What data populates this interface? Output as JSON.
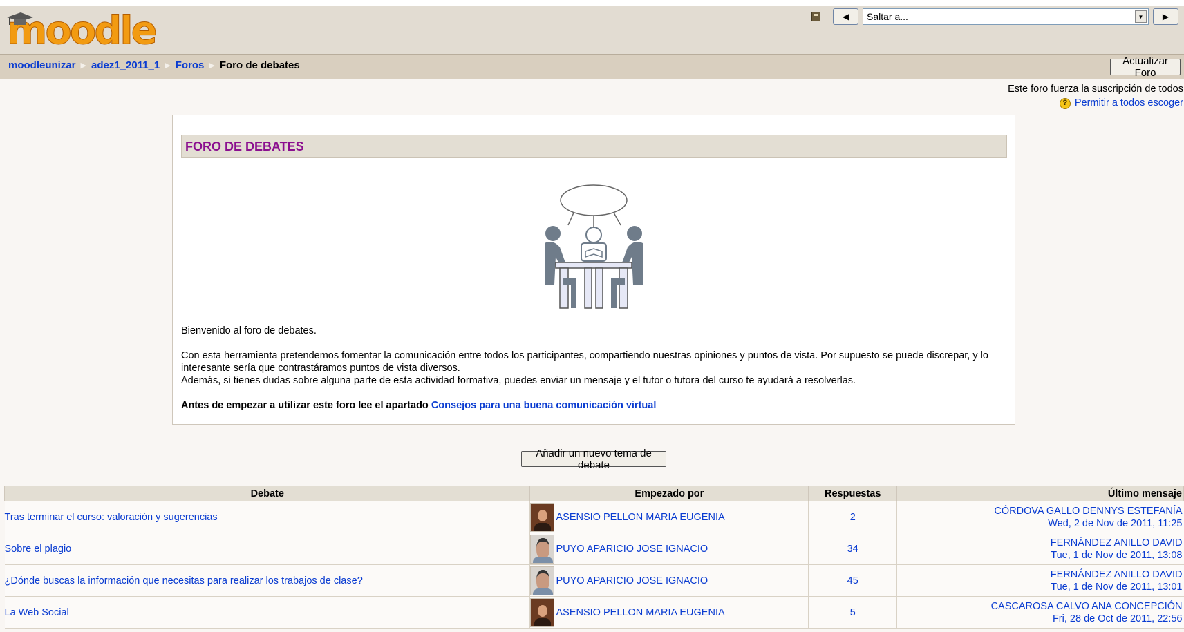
{
  "logo": {
    "text": "moodle"
  },
  "header": {
    "jump_select": {
      "value": "Saltar a..."
    },
    "prev_label": "◀",
    "next_label": "▶"
  },
  "breadcrumb": {
    "items": [
      "moodleunizar",
      "adez1_2011_1",
      "Foros"
    ],
    "current": "Foro de debates"
  },
  "update_button": "Actualizar Foro",
  "subscription": {
    "notice": "Este foro fuerza la suscripción de todos",
    "link": "Permitir a todos escoger"
  },
  "forum": {
    "heading": "FORO DE DEBATES",
    "welcome": "Bienvenido al foro de debates.",
    "paragraph1": "Con esta herramienta pretendemos fomentar la comunicación entre todos los participantes, compartiendo nuestras opiniones y puntos de vista. Por supuesto se puede discrepar, y lo interesante sería que contrastáramos puntos de vista diversos.",
    "paragraph2": "Además, si tienes dudas sobre alguna parte de esta actividad formativa, puedes enviar un mensaje y el tutor o tutora del curso te ayudará a resolverlas.",
    "advice_prefix": "Antes de empezar a utilizar este foro lee el apartado ",
    "advice_link": "Consejos para una buena comunicación virtual"
  },
  "add_topic_button": "Añadir un nuevo tema de debate",
  "table": {
    "headers": {
      "debate": "Debate",
      "started_by": "Empezado por",
      "replies": "Respuestas",
      "last_post": "Último mensaje"
    },
    "rows": [
      {
        "debate": "Tras terminar el curso: valoración y sugerencias",
        "avatar": "woman",
        "started_by": "ASENSIO PELLON MARIA EUGENIA",
        "replies": "2",
        "last_author": "CÓRDOVA GALLO DENNYS ESTEFANÍA",
        "last_date": "Wed, 2 de Nov de 2011, 11:25"
      },
      {
        "debate": "Sobre el plagio",
        "avatar": "man",
        "started_by": "PUYO APARICIO JOSE IGNACIO",
        "replies": "34",
        "last_author": "FERNÁNDEZ ANILLO DAVID",
        "last_date": "Tue, 1 de Nov de 2011, 13:08"
      },
      {
        "debate": "¿Dónde buscas la información que necesitas para realizar los trabajos de clase?",
        "avatar": "man",
        "started_by": "PUYO APARICIO JOSE IGNACIO",
        "replies": "45",
        "last_author": "FERNÁNDEZ ANILLO DAVID",
        "last_date": "Tue, 1 de Nov de 2011, 13:01"
      },
      {
        "debate": "La Web Social",
        "avatar": "woman",
        "started_by": "ASENSIO PELLON MARIA EUGENIA",
        "replies": "5",
        "last_author": "CASCAROSA CALVO ANA CONCEPCIÓN",
        "last_date": "Fri, 28 de Oct de 2011, 22:56"
      }
    ]
  },
  "colors": {
    "accent_heading": "#8b0f8f",
    "link": "#0a3cd1",
    "header_bg": "#e2dcd2"
  }
}
